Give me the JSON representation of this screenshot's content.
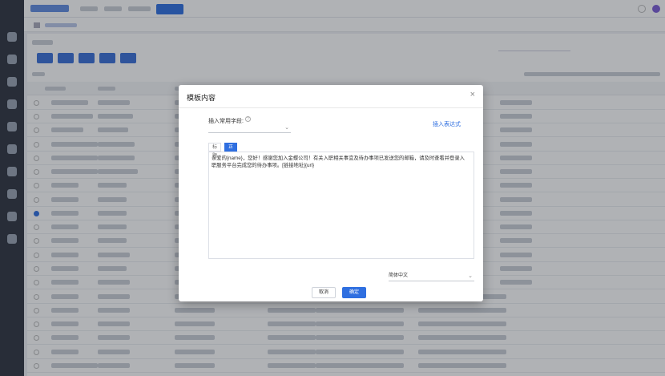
{
  "modal": {
    "title": "模板内容",
    "close_icon": "close-icon",
    "field_label": "插入常用字段:",
    "help_icon": "question-circle-icon",
    "field_value": "",
    "insert_expression_link": "插入表达式",
    "tabs": [
      {
        "label": "标题",
        "active": false
      },
      {
        "label": "正文",
        "active": true
      }
    ],
    "body_text": "亲爱的{name}，您好！感谢您加入金蝶公司！有关入职相关事宜及待办事项已发送您的邮箱，请及时查看并登录入职服务平台完成您的待办事项。[链接地址]{url}",
    "language": "简体中文",
    "cancel_label": "取消",
    "confirm_label": "确定"
  },
  "colors": {
    "accent": "#2f6fe0",
    "sidebar": "#2e3440",
    "overlay": "rgba(30,34,42,0.35)"
  }
}
